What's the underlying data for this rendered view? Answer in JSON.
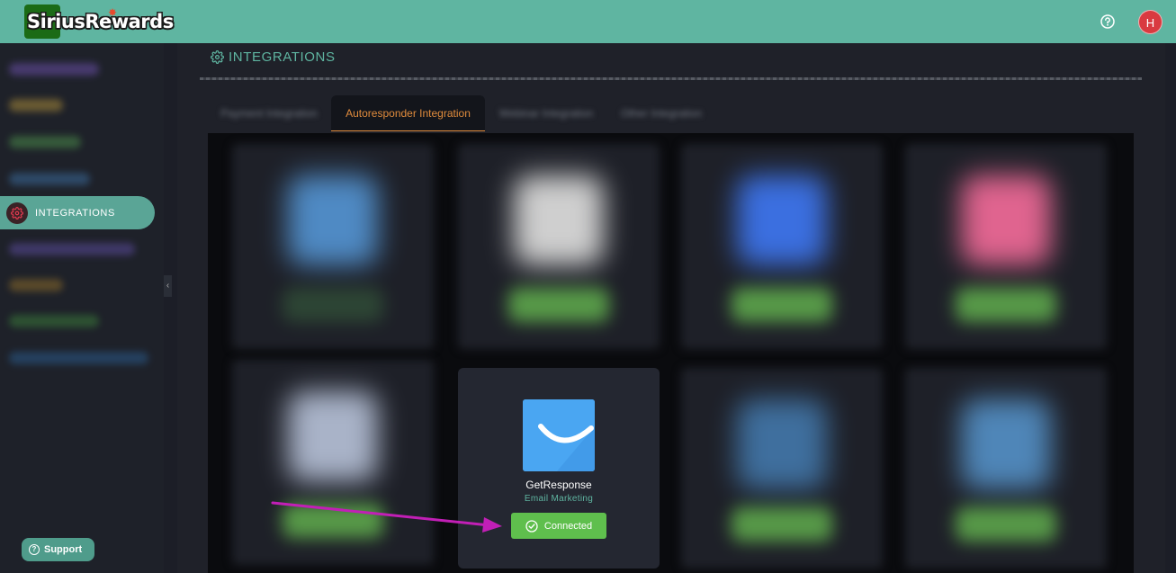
{
  "header": {
    "logo_text": "SiriusRewards",
    "avatar_initial": "H"
  },
  "sidebar": {
    "active_item": "INTEGRATIONS",
    "support_label": "Support"
  },
  "page": {
    "title": "INTEGRATIONS"
  },
  "tabs": [
    {
      "label": "Payment Integration",
      "active": false
    },
    {
      "label": "Autoresponder Integration",
      "active": true
    },
    {
      "label": "Webinar Integration",
      "active": false
    },
    {
      "label": "Other Integration",
      "active": false
    }
  ],
  "featured_integration": {
    "name": "GetResponse",
    "category": "Email Marketing",
    "status": "Connected"
  },
  "colors": {
    "accent_teal": "#5fb5a1",
    "active_tab": "#e08b3c",
    "connected_green": "#5fbf4d",
    "avatar_red": "#d93a40",
    "annotation_arrow": "#c21fb6"
  },
  "icons": [
    "help-icon",
    "gear-icon",
    "check-circle-icon",
    "chevron-left-icon"
  ]
}
